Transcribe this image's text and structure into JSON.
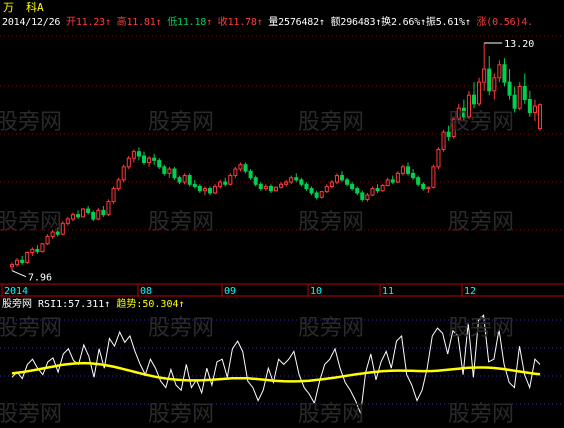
{
  "header": {
    "stock_name": "万",
    "stock_name_2": "科A",
    "date": "2014/12/26",
    "open_label": "开",
    "open": "11.23",
    "high_label": "高",
    "high": "11.81",
    "low_label": "低",
    "low": "11.18",
    "close_label": "收",
    "close": "11.78",
    "volume_label": "量",
    "volume": "2576482",
    "amount_label": "额",
    "amount": "296483",
    "turnover_label": "换",
    "turnover": "2.66%",
    "amplitude_label": "振",
    "amplitude": "5.61%",
    "change_label": "涨",
    "change": "(0.56)",
    "change_trunc": "4."
  },
  "watermark": "股旁网",
  "colors": {
    "up": "#ff3b3b",
    "down": "#00d050",
    "axis": "#c00000",
    "grid": "#8a0000",
    "rsi": "#ffffff",
    "trend": "#ffff00",
    "text_white": "#ffffff",
    "text_cyan": "#00ffff",
    "text_yellow": "#ffff00"
  },
  "indicator": {
    "name": "股旁网",
    "rsi_label": "RSI1:",
    "rsi_value": "57.311",
    "trend_label": "趋势:",
    "trend_value": "50.304"
  },
  "chart_data": {
    "type": "candlestick",
    "x_ticks": [
      "2014",
      "08",
      "09",
      "10",
      "11",
      "12"
    ],
    "annotations": {
      "low_price": "7.96",
      "high_price": "13.20"
    },
    "price_range": [
      7.7,
      13.5
    ],
    "candles": [
      [
        8.05,
        8.15,
        7.96,
        8.1
      ],
      [
        8.1,
        8.25,
        8.05,
        8.2
      ],
      [
        8.2,
        8.3,
        8.1,
        8.15
      ],
      [
        8.15,
        8.4,
        8.12,
        8.38
      ],
      [
        8.38,
        8.5,
        8.3,
        8.45
      ],
      [
        8.45,
        8.55,
        8.35,
        8.4
      ],
      [
        8.4,
        8.6,
        8.38,
        8.58
      ],
      [
        8.58,
        8.8,
        8.55,
        8.75
      ],
      [
        8.75,
        8.9,
        8.7,
        8.85
      ],
      [
        8.85,
        8.95,
        8.75,
        8.8
      ],
      [
        8.8,
        9.1,
        8.78,
        9.05
      ],
      [
        9.05,
        9.2,
        9.0,
        9.15
      ],
      [
        9.15,
        9.3,
        9.1,
        9.25
      ],
      [
        9.25,
        9.35,
        9.15,
        9.2
      ],
      [
        9.2,
        9.4,
        9.18,
        9.38
      ],
      [
        9.38,
        9.45,
        9.25,
        9.3
      ],
      [
        9.3,
        9.35,
        9.1,
        9.15
      ],
      [
        9.15,
        9.4,
        9.12,
        9.35
      ],
      [
        9.35,
        9.45,
        9.2,
        9.25
      ],
      [
        9.25,
        9.6,
        9.22,
        9.55
      ],
      [
        9.55,
        9.9,
        9.5,
        9.85
      ],
      [
        9.85,
        10.1,
        9.8,
        10.05
      ],
      [
        10.05,
        10.4,
        10.0,
        10.35
      ],
      [
        10.35,
        10.6,
        10.3,
        10.55
      ],
      [
        10.55,
        10.75,
        10.45,
        10.7
      ],
      [
        10.7,
        10.8,
        10.5,
        10.6
      ],
      [
        10.6,
        10.7,
        10.4,
        10.45
      ],
      [
        10.45,
        10.6,
        10.35,
        10.55
      ],
      [
        10.55,
        10.65,
        10.4,
        10.5
      ],
      [
        10.5,
        10.55,
        10.3,
        10.35
      ],
      [
        10.35,
        10.4,
        10.15,
        10.2
      ],
      [
        10.2,
        10.35,
        10.1,
        10.3
      ],
      [
        10.3,
        10.35,
        10.05,
        10.1
      ],
      [
        10.1,
        10.15,
        9.95,
        10.0
      ],
      [
        10.0,
        10.2,
        9.95,
        10.15
      ],
      [
        10.15,
        10.2,
        9.9,
        9.95
      ],
      [
        9.95,
        10.05,
        9.85,
        9.9
      ],
      [
        9.9,
        9.95,
        9.75,
        9.8
      ],
      [
        9.8,
        9.9,
        9.7,
        9.85
      ],
      [
        9.85,
        9.9,
        9.7,
        9.75
      ],
      [
        9.75,
        9.95,
        9.72,
        9.9
      ],
      [
        9.9,
        10.05,
        9.85,
        10.0
      ],
      [
        10.0,
        10.1,
        9.9,
        9.95
      ],
      [
        9.95,
        10.2,
        9.92,
        10.15
      ],
      [
        10.15,
        10.35,
        10.1,
        10.3
      ],
      [
        10.3,
        10.45,
        10.25,
        10.4
      ],
      [
        10.4,
        10.45,
        10.2,
        10.25
      ],
      [
        10.25,
        10.3,
        10.05,
        10.1
      ],
      [
        10.1,
        10.15,
        9.9,
        9.95
      ],
      [
        9.95,
        10.0,
        9.8,
        9.85
      ],
      [
        9.85,
        9.95,
        9.8,
        9.9
      ],
      [
        9.9,
        9.95,
        9.75,
        9.8
      ],
      [
        9.8,
        9.9,
        9.78,
        9.88
      ],
      [
        9.88,
        10.0,
        9.85,
        9.95
      ],
      [
        9.95,
        10.05,
        9.9,
        10.0
      ],
      [
        10.0,
        10.15,
        9.95,
        10.1
      ],
      [
        10.1,
        10.2,
        10.0,
        10.05
      ],
      [
        10.05,
        10.1,
        9.9,
        9.95
      ],
      [
        9.95,
        10.0,
        9.8,
        9.85
      ],
      [
        9.85,
        9.9,
        9.7,
        9.75
      ],
      [
        9.75,
        9.8,
        9.6,
        9.65
      ],
      [
        9.65,
        9.8,
        9.62,
        9.78
      ],
      [
        9.78,
        9.95,
        9.75,
        9.9
      ],
      [
        9.9,
        10.05,
        9.85,
        10.0
      ],
      [
        10.0,
        10.2,
        9.95,
        10.15
      ],
      [
        10.15,
        10.25,
        10.0,
        10.05
      ],
      [
        10.05,
        10.1,
        9.9,
        9.95
      ],
      [
        9.95,
        10.0,
        9.8,
        9.85
      ],
      [
        9.85,
        9.9,
        9.7,
        9.75
      ],
      [
        9.75,
        9.8,
        9.55,
        9.6
      ],
      [
        9.6,
        9.75,
        9.55,
        9.7
      ],
      [
        9.7,
        9.9,
        9.68,
        9.85
      ],
      [
        9.85,
        9.95,
        9.75,
        9.8
      ],
      [
        9.8,
        9.95,
        9.78,
        9.92
      ],
      [
        9.92,
        10.1,
        9.9,
        10.05
      ],
      [
        10.05,
        10.15,
        9.95,
        10.0
      ],
      [
        10.0,
        10.25,
        9.98,
        10.2
      ],
      [
        10.2,
        10.4,
        10.15,
        10.35
      ],
      [
        10.35,
        10.45,
        10.15,
        10.2
      ],
      [
        10.2,
        10.3,
        10.05,
        10.1
      ],
      [
        10.1,
        10.15,
        9.9,
        9.95
      ],
      [
        9.95,
        10.0,
        9.8,
        9.85
      ],
      [
        9.85,
        9.9,
        9.75,
        9.88
      ],
      [
        9.88,
        10.4,
        9.85,
        10.35
      ],
      [
        10.35,
        10.8,
        10.3,
        10.75
      ],
      [
        10.75,
        11.2,
        10.7,
        11.15
      ],
      [
        11.15,
        11.3,
        10.95,
        11.05
      ],
      [
        11.05,
        11.5,
        11.0,
        11.45
      ],
      [
        11.45,
        11.8,
        11.35,
        11.7
      ],
      [
        11.7,
        11.9,
        11.4,
        11.5
      ],
      [
        11.5,
        12.1,
        11.45,
        12.0
      ],
      [
        12.0,
        12.3,
        11.7,
        11.8
      ],
      [
        11.8,
        12.4,
        11.75,
        12.3
      ],
      [
        12.3,
        13.2,
        12.1,
        12.6
      ],
      [
        12.6,
        12.9,
        12.0,
        12.1
      ],
      [
        12.1,
        12.5,
        11.9,
        12.4
      ],
      [
        12.4,
        12.8,
        12.3,
        12.7
      ],
      [
        12.7,
        12.85,
        12.2,
        12.3
      ],
      [
        12.3,
        12.6,
        11.9,
        12.0
      ],
      [
        12.0,
        12.2,
        11.6,
        11.7
      ],
      [
        11.7,
        12.3,
        11.65,
        12.2
      ],
      [
        12.2,
        12.5,
        11.8,
        11.9
      ],
      [
        11.9,
        12.1,
        11.5,
        11.6
      ],
      [
        11.6,
        11.9,
        11.4,
        11.75
      ],
      [
        11.23,
        11.81,
        11.18,
        11.78
      ]
    ],
    "rsi": [
      48,
      52,
      47,
      58,
      62,
      55,
      50,
      60,
      63,
      52,
      66,
      70,
      61,
      58,
      73,
      64,
      48,
      70,
      55,
      78,
      72,
      83,
      75,
      80,
      68,
      58,
      50,
      62,
      55,
      45,
      40,
      54,
      42,
      38,
      58,
      40,
      46,
      36,
      55,
      42,
      60,
      62,
      48,
      70,
      76,
      68,
      45,
      40,
      30,
      38,
      55,
      44,
      62,
      58,
      62,
      68,
      50,
      40,
      35,
      28,
      45,
      58,
      62,
      70,
      55,
      44,
      38,
      30,
      20,
      52,
      66,
      46,
      60,
      68,
      55,
      76,
      80,
      50,
      42,
      30,
      38,
      55,
      80,
      86,
      82,
      66,
      84,
      80,
      50,
      90,
      48,
      92,
      96,
      60,
      62,
      85,
      58,
      44,
      40,
      72,
      50,
      40,
      62,
      58
    ],
    "trend": [
      51,
      51.5,
      52,
      52.6,
      53.3,
      54,
      54.8,
      55.6,
      56.3,
      57,
      57.7,
      58.2,
      58.6,
      58.9,
      59,
      58.9,
      58.6,
      58.1,
      57.5,
      56.8,
      56,
      55.1,
      54.1,
      53.1,
      52.1,
      51.1,
      50.1,
      49.2,
      48.4,
      47.7,
      47.1,
      46.6,
      46.2,
      45.9,
      45.7,
      45.6,
      45.6,
      45.7,
      45.9,
      46.1,
      46.4,
      46.7,
      47,
      47.2,
      47.3,
      47.3,
      47.2,
      46.9,
      46.6,
      46.2,
      45.8,
      45.4,
      45.1,
      44.9,
      44.8,
      44.8,
      44.9,
      45.1,
      45.4,
      45.8,
      46.2,
      46.7,
      47.2,
      47.8,
      48.4,
      49,
      49.6,
      50.2,
      50.8,
      51.3,
      51.8,
      52.2,
      52.6,
      52.9,
      53.1,
      53.2,
      53.2,
      53.1,
      53,
      52.9,
      52.8,
      52.8,
      52.9,
      53.1,
      53.4,
      53.8,
      54.2,
      54.6,
      55,
      55.3,
      55.5,
      55.6,
      55.6,
      55.5,
      55.2,
      54.8,
      54.3,
      53.7,
      53.1,
      52.5,
      51.9,
      51.3,
      50.8,
      50.3
    ]
  }
}
